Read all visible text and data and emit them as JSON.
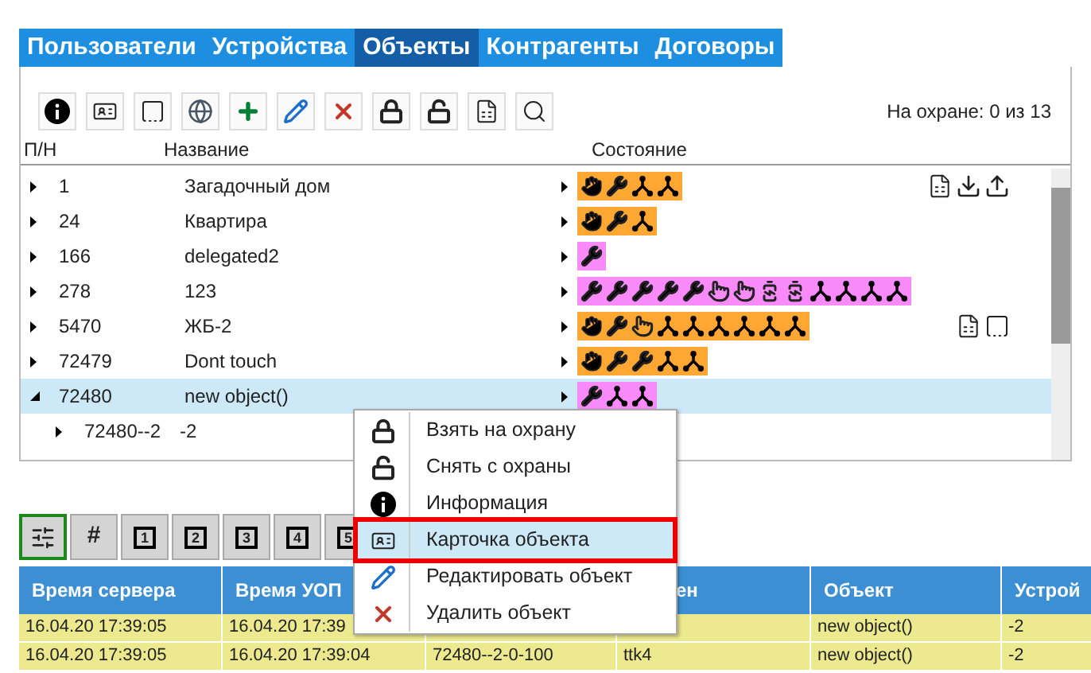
{
  "tabs": [
    {
      "label": "Пользователи",
      "selected": false
    },
    {
      "label": "Устройства",
      "selected": false
    },
    {
      "label": "Объекты",
      "selected": true
    },
    {
      "label": "Контрагенты",
      "selected": false
    },
    {
      "label": "Договоры",
      "selected": false
    }
  ],
  "toolbar": {
    "guarded": "На охране: 0 из 13"
  },
  "tree": {
    "columns": [
      "П/Н",
      "Название",
      "Состояние"
    ],
    "rows": [
      {
        "id": "1",
        "name": "Загадочный дом",
        "expanded": false,
        "selected": false,
        "status": {
          "color": "#ffa733",
          "icons": [
            {
              "kind": "hand"
            },
            {
              "kind": "wrench"
            },
            {
              "kind": "node"
            },
            {
              "kind": "node"
            }
          ]
        },
        "actions": [
          {
            "kind": "report"
          },
          {
            "kind": "download"
          },
          {
            "kind": "upload"
          }
        ]
      },
      {
        "id": "24",
        "name": "Квартира",
        "expanded": false,
        "selected": false,
        "status": {
          "color": "#ffa733",
          "icons": [
            {
              "kind": "hand"
            },
            {
              "kind": "wrench"
            },
            {
              "kind": "node"
            }
          ]
        }
      },
      {
        "id": "166",
        "name": "delegated2",
        "expanded": false,
        "selected": false,
        "status": {
          "color": "#f98af9",
          "icons": [
            {
              "kind": "wrench"
            }
          ]
        }
      },
      {
        "id": "278",
        "name": "123",
        "expanded": false,
        "selected": false,
        "status": {
          "color": "#f98af9",
          "icons": [
            {
              "kind": "wrench"
            },
            {
              "kind": "wrench"
            },
            {
              "kind": "wrench"
            },
            {
              "kind": "wrench"
            },
            {
              "kind": "wrench"
            },
            {
              "kind": "touch"
            },
            {
              "kind": "touch"
            },
            {
              "kind": "battery"
            },
            {
              "kind": "battery"
            },
            {
              "kind": "node"
            },
            {
              "kind": "node"
            },
            {
              "kind": "node"
            },
            {
              "kind": "node"
            }
          ]
        }
      },
      {
        "id": "5470",
        "name": "ЖБ-2",
        "expanded": false,
        "selected": false,
        "status": {
          "color": "#ffa733",
          "icons": [
            {
              "kind": "hand"
            },
            {
              "kind": "wrench"
            },
            {
              "kind": "touch"
            },
            {
              "kind": "node"
            },
            {
              "kind": "node"
            },
            {
              "kind": "node"
            },
            {
              "kind": "node"
            },
            {
              "kind": "node"
            },
            {
              "kind": "node"
            }
          ]
        },
        "actions": [
          {
            "kind": "report"
          },
          {
            "kind": "frame"
          }
        ]
      },
      {
        "id": "72479",
        "name": "Dont touch",
        "expanded": false,
        "selected": false,
        "status": {
          "color": "#ffa733",
          "icons": [
            {
              "kind": "hand"
            },
            {
              "kind": "wrench"
            },
            {
              "kind": "wrench"
            },
            {
              "kind": "node"
            },
            {
              "kind": "node"
            }
          ]
        }
      },
      {
        "id": "72480",
        "name": "new object()",
        "expanded": true,
        "selected": true,
        "status": {
          "color": "#f98af9",
          "icons": [
            {
              "kind": "wrench"
            },
            {
              "kind": "node"
            },
            {
              "kind": "node"
            }
          ]
        },
        "children": [
          {
            "id": "72480--2",
            "name": "-2",
            "expanded": false
          }
        ]
      }
    ]
  },
  "bottom_toolbar": [
    {
      "kind": "filter",
      "selected": true
    },
    {
      "label": "#",
      "kind": "text",
      "selected": false
    },
    {
      "label": "1",
      "kind": "boxed",
      "selected": false
    },
    {
      "label": "2",
      "kind": "boxed",
      "selected": false
    },
    {
      "label": "3",
      "kind": "boxed",
      "selected": false
    },
    {
      "label": "4",
      "kind": "boxed",
      "selected": false
    },
    {
      "label": "5",
      "kind": "boxed",
      "selected": false
    }
  ],
  "events": {
    "columns": [
      "Время сервера",
      "Время УОП",
      "",
      "ен",
      "Объект",
      "Устрой"
    ],
    "rows": [
      [
        "16.04.20 17:39:05",
        "16.04.20 17:39",
        "",
        "",
        "new object()",
        "-2"
      ],
      [
        "16.04.20 17:39:05",
        "16.04.20 17:39:04",
        "72480--2-0-100",
        "ttk4",
        "new object()",
        "-2"
      ]
    ]
  },
  "context_menu": [
    {
      "label": "Взять на охрану",
      "selected": false
    },
    {
      "label": "Снять с охраны",
      "selected": false
    },
    {
      "label": "Информация",
      "selected": false
    },
    {
      "label": "Карточка объекта",
      "selected": true
    },
    {
      "label": "Редактировать объект",
      "selected": false
    },
    {
      "label": "Удалить объект",
      "selected": false
    }
  ]
}
